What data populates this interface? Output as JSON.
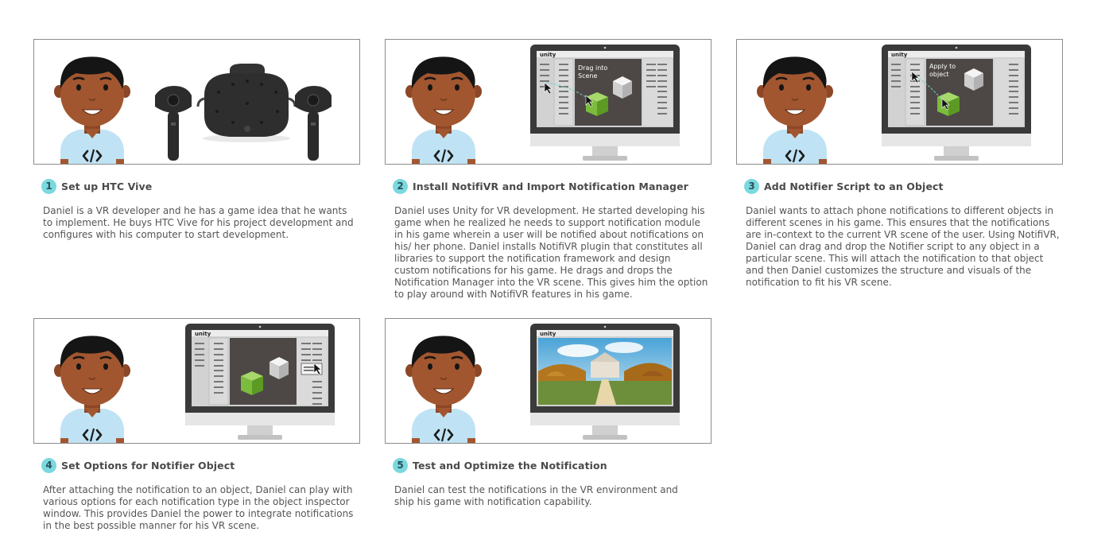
{
  "steps": [
    {
      "number": "1",
      "title": "Set up HTC Vive",
      "description": "Daniel is a VR developer and he has a game idea that he wants to implement. He buys HTC Vive for his project development and configures with his computer to start development."
    },
    {
      "number": "2",
      "title": "Install NotifiVR and Import Notification Manager",
      "description": "Daniel uses Unity for VR development. He started developing his game when he realized he needs to support notification module in his game wherein a user will be notified about notifications on his/ her phone. Daniel installs NotifiVR plugin that constitutes all libraries to support the notification framework and design custom notifications for his game. He drags and drops the Notification Manager into the VR scene. This gives him the option to play around with NotifiVR features in his game.",
      "overlay": "Drag into Scene"
    },
    {
      "number": "3",
      "title": "Add Notifier Script to an Object",
      "description": "Daniel wants to attach phone notifications to different objects in different scenes in his game. This ensures that the notifications are in-context to the current VR scene of the user. Using NotifiVR, Daniel can drag and drop the Notifier script to any object in a particular scene. This will attach the notification to that object and then Daniel customizes the structure and visuals of the notification to fit his VR scene.",
      "overlay": "Apply to object"
    },
    {
      "number": "4",
      "title": "Set Options for Notifier Object",
      "description": "After attaching the notification to an object, Daniel can play with various options for each notification type in the object inspector window. This provides Daniel the power to integrate notifications in the best possible manner for his VR scene."
    },
    {
      "number": "5",
      "title": "Test and Optimize the Notification",
      "description": "Daniel can test the notifications in the VR environment and ship his game with notification capability."
    }
  ],
  "unity_logo_text": "unity",
  "colors": {
    "badge": "#7ad9df",
    "skin": "#a2562f",
    "shirt": "#bfe3f4",
    "monitor_bezel": "#3a3a3a",
    "scene_bg": "#4d4846",
    "cube_green": "#7cbc3c"
  }
}
